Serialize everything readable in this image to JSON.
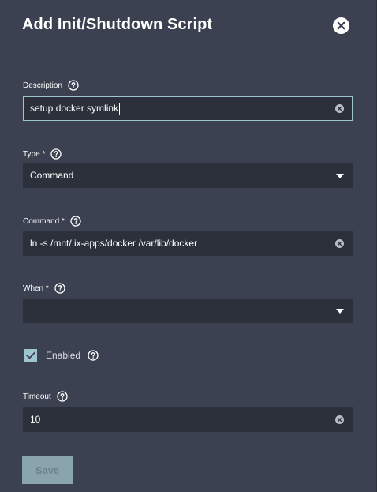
{
  "dialog": {
    "title": "Add Init/Shutdown Script"
  },
  "form": {
    "description": {
      "label": "Description",
      "value": "setup docker symlink"
    },
    "type": {
      "label": "Type *",
      "value": "Command"
    },
    "command": {
      "label": "Command *",
      "value": "ln -s /mnt/.ix-apps/docker /var/lib/docker"
    },
    "when": {
      "label": "When *",
      "value": ""
    },
    "enabled": {
      "label": "Enabled",
      "checked": true
    },
    "timeout": {
      "label": "Timeout",
      "value": "10"
    }
  },
  "actions": {
    "save_label": "Save"
  },
  "icons": {
    "close": "close-icon",
    "help": "help-icon",
    "clear": "clear-icon",
    "dropdown": "chevron-down-icon",
    "check": "check-icon"
  },
  "colors": {
    "background": "#3b4150",
    "field_background": "#2b303b",
    "focus_border": "#9ec5d0",
    "checkbox_fill": "#9ec5d0",
    "button_disabled": "#8aa4ae"
  }
}
